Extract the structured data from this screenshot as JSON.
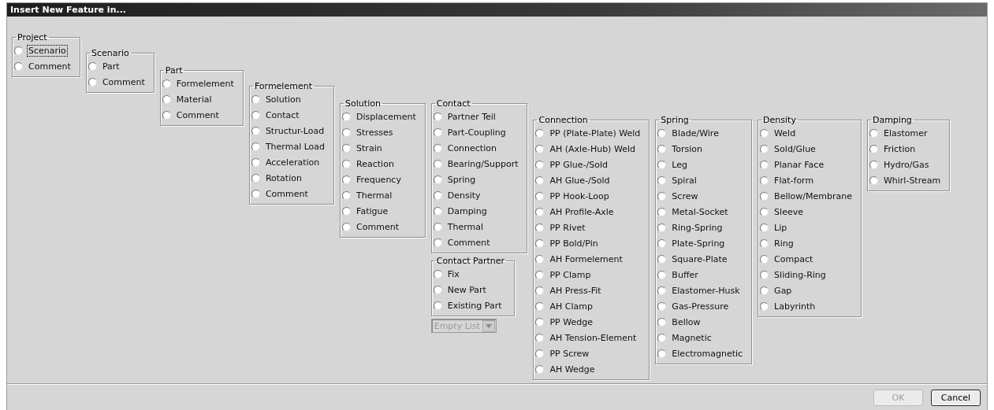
{
  "window": {
    "title": "Insert New Feature in..."
  },
  "columns": [
    {
      "groups": [
        {
          "title": "Project",
          "options": [
            {
              "label": "Scenario",
              "selected": false,
              "focused": true
            },
            {
              "label": "Comment",
              "selected": false,
              "focused": false
            }
          ]
        }
      ]
    },
    {
      "groups": [
        {
          "title": "Scenario",
          "options": [
            {
              "label": "Part",
              "selected": false,
              "focused": false
            },
            {
              "label": "Comment",
              "selected": false,
              "focused": false
            }
          ]
        }
      ]
    },
    {
      "groups": [
        {
          "title": "Part",
          "options": [
            {
              "label": "Formelement",
              "selected": false,
              "focused": false
            },
            {
              "label": "Material",
              "selected": false,
              "focused": false
            },
            {
              "label": "Comment",
              "selected": false,
              "focused": false
            }
          ]
        }
      ]
    },
    {
      "groups": [
        {
          "title": "Formelement",
          "options": [
            {
              "label": "Solution",
              "selected": false,
              "focused": false
            },
            {
              "label": "Contact",
              "selected": false,
              "focused": false
            },
            {
              "label": "Structur-Load",
              "selected": false,
              "focused": false
            },
            {
              "label": "Thermal Load",
              "selected": false,
              "focused": false
            },
            {
              "label": "Acceleration",
              "selected": false,
              "focused": false
            },
            {
              "label": "Rotation",
              "selected": false,
              "focused": false
            },
            {
              "label": "Comment",
              "selected": false,
              "focused": false
            }
          ]
        }
      ]
    },
    {
      "groups": [
        {
          "title": "Solution",
          "options": [
            {
              "label": "Displacement",
              "selected": false,
              "focused": false
            },
            {
              "label": "Stresses",
              "selected": false,
              "focused": false
            },
            {
              "label": "Strain",
              "selected": false,
              "focused": false
            },
            {
              "label": "Reaction",
              "selected": false,
              "focused": false
            },
            {
              "label": "Frequency",
              "selected": false,
              "focused": false
            },
            {
              "label": "Thermal",
              "selected": false,
              "focused": false
            },
            {
              "label": "Fatigue",
              "selected": false,
              "focused": false
            },
            {
              "label": "Comment",
              "selected": false,
              "focused": false
            }
          ]
        }
      ]
    },
    {
      "groups": [
        {
          "title": "Contact",
          "options": [
            {
              "label": "Partner Teil",
              "selected": false,
              "focused": false
            },
            {
              "label": "Part-Coupling",
              "selected": false,
              "focused": false
            },
            {
              "label": "Connection",
              "selected": false,
              "focused": false
            },
            {
              "label": "Bearing/Support",
              "selected": false,
              "focused": false
            },
            {
              "label": "Spring",
              "selected": false,
              "focused": false
            },
            {
              "label": "Density",
              "selected": false,
              "focused": false
            },
            {
              "label": "Damping",
              "selected": false,
              "focused": false
            },
            {
              "label": "Thermal",
              "selected": false,
              "focused": false
            },
            {
              "label": "Comment",
              "selected": false,
              "focused": false
            }
          ]
        },
        {
          "title": "Contact Partner",
          "options": [
            {
              "label": "Fix",
              "selected": false,
              "focused": false
            },
            {
              "label": "New Part",
              "selected": false,
              "focused": false
            },
            {
              "label": "Existing Part",
              "selected": false,
              "focused": false
            }
          ]
        }
      ],
      "dropdown": {
        "value": "Empty List",
        "disabled": true
      }
    },
    {
      "groups": [
        {
          "title": "Connection",
          "options": [
            {
              "label": "PP (Plate-Plate) Weld",
              "selected": false,
              "focused": false
            },
            {
              "label": "AH (Axle-Hub) Weld",
              "selected": false,
              "focused": false
            },
            {
              "label": "PP Glue-/Sold",
              "selected": false,
              "focused": false
            },
            {
              "label": "AH Glue-/Sold",
              "selected": false,
              "focused": false
            },
            {
              "label": "PP Hook-Loop",
              "selected": false,
              "focused": false
            },
            {
              "label": "AH Profile-Axle",
              "selected": false,
              "focused": false
            },
            {
              "label": "PP Rivet",
              "selected": false,
              "focused": false
            },
            {
              "label": "PP Bold/Pin",
              "selected": false,
              "focused": false
            },
            {
              "label": "AH Formelement",
              "selected": false,
              "focused": false
            },
            {
              "label": "PP Clamp",
              "selected": false,
              "focused": false
            },
            {
              "label": "AH Press-Fit",
              "selected": false,
              "focused": false
            },
            {
              "label": "AH Clamp",
              "selected": false,
              "focused": false
            },
            {
              "label": "PP Wedge",
              "selected": false,
              "focused": false
            },
            {
              "label": "AH Tension-Element",
              "selected": false,
              "focused": false
            },
            {
              "label": "PP Screw",
              "selected": false,
              "focused": false
            },
            {
              "label": "AH Wedge",
              "selected": false,
              "focused": false
            }
          ]
        }
      ]
    },
    {
      "groups": [
        {
          "title": "Spring",
          "options": [
            {
              "label": "Blade/Wire",
              "selected": false,
              "focused": false
            },
            {
              "label": "Torsion",
              "selected": false,
              "focused": false
            },
            {
              "label": "Leg",
              "selected": false,
              "focused": false
            },
            {
              "label": "Spiral",
              "selected": false,
              "focused": false
            },
            {
              "label": "Screw",
              "selected": false,
              "focused": false
            },
            {
              "label": "Metal-Socket",
              "selected": false,
              "focused": false
            },
            {
              "label": "Ring-Spring",
              "selected": false,
              "focused": false
            },
            {
              "label": "Plate-Spring",
              "selected": false,
              "focused": false
            },
            {
              "label": "Square-Plate",
              "selected": false,
              "focused": false
            },
            {
              "label": "Buffer",
              "selected": false,
              "focused": false
            },
            {
              "label": "Elastomer-Husk",
              "selected": false,
              "focused": false
            },
            {
              "label": "Gas-Pressure",
              "selected": false,
              "focused": false
            },
            {
              "label": "Bellow",
              "selected": false,
              "focused": false
            },
            {
              "label": "Magnetic",
              "selected": false,
              "focused": false
            },
            {
              "label": "Electromagnetic",
              "selected": false,
              "focused": false
            }
          ]
        }
      ]
    },
    {
      "groups": [
        {
          "title": "Density",
          "options": [
            {
              "label": "Weld",
              "selected": false,
              "focused": false
            },
            {
              "label": "Sold/Glue",
              "selected": false,
              "focused": false
            },
            {
              "label": "Planar Face",
              "selected": false,
              "focused": false
            },
            {
              "label": "Flat-form",
              "selected": false,
              "focused": false
            },
            {
              "label": "Bellow/Membrane",
              "selected": false,
              "focused": false
            },
            {
              "label": "Sleeve",
              "selected": false,
              "focused": false
            },
            {
              "label": "Lip",
              "selected": false,
              "focused": false
            },
            {
              "label": "Ring",
              "selected": false,
              "focused": false
            },
            {
              "label": "Compact",
              "selected": false,
              "focused": false
            },
            {
              "label": "Sliding-Ring",
              "selected": false,
              "focused": false
            },
            {
              "label": "Gap",
              "selected": false,
              "focused": false
            },
            {
              "label": "Labyrinth",
              "selected": false,
              "focused": false
            }
          ]
        }
      ]
    },
    {
      "groups": [
        {
          "title": "Damping",
          "options": [
            {
              "label": "Elastomer",
              "selected": false,
              "focused": false
            },
            {
              "label": "Friction",
              "selected": false,
              "focused": false
            },
            {
              "label": "Hydro/Gas",
              "selected": false,
              "focused": false
            },
            {
              "label": "Whirl-Stream",
              "selected": false,
              "focused": false
            }
          ]
        }
      ]
    }
  ],
  "buttons": [
    {
      "label": "OK",
      "disabled": true,
      "default": false
    },
    {
      "label": "Cancel",
      "disabled": false,
      "default": true
    }
  ]
}
